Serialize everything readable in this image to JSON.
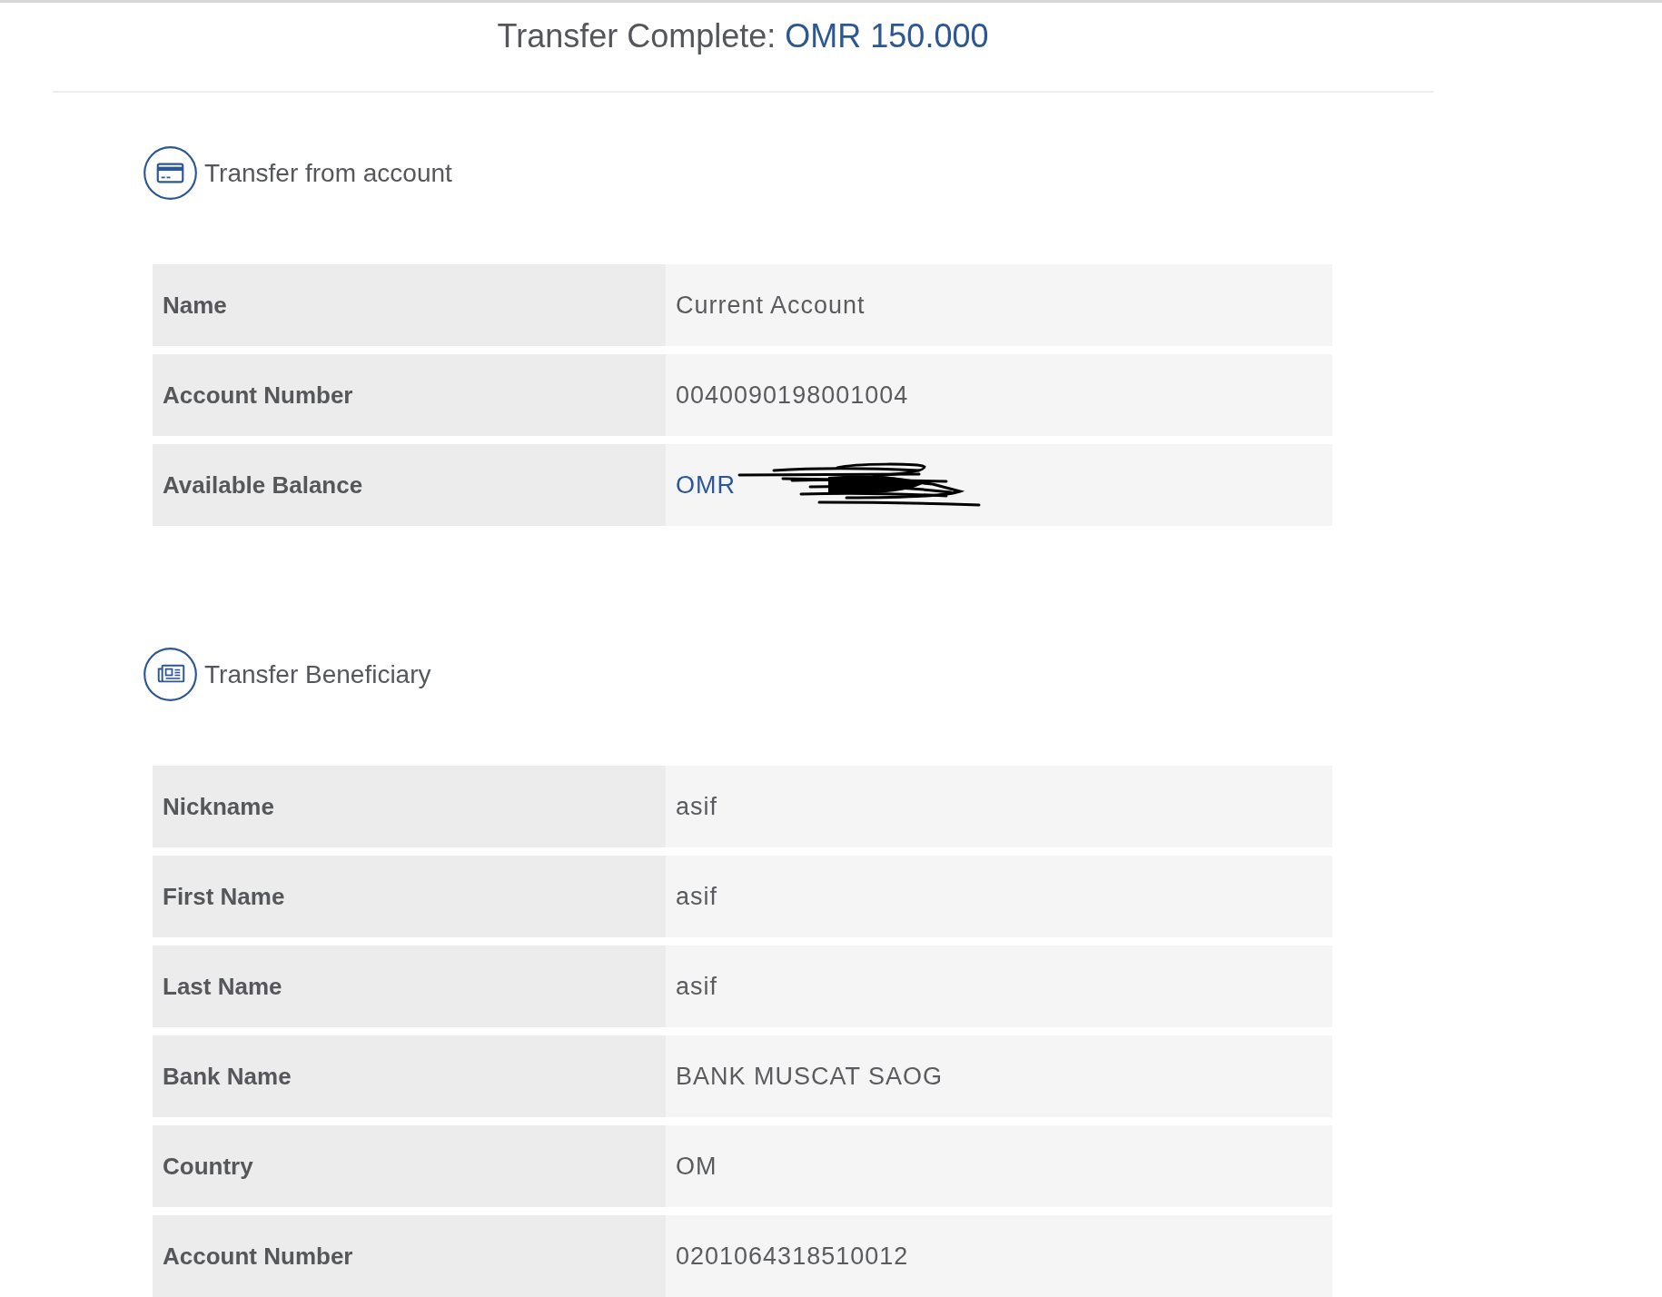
{
  "header": {
    "title": "Transfer Complete:",
    "amount": "OMR 150.000"
  },
  "sections": [
    {
      "kind": "account",
      "title": "Transfer from account",
      "rows": [
        {
          "label": "Name",
          "value": "Current Account",
          "kind": "text",
          "redacted": false
        },
        {
          "label": "Account Number",
          "value": "0040090198001004",
          "kind": "text",
          "redacted": false
        },
        {
          "label": "Available Balance",
          "value": "OMR",
          "kind": "amount",
          "redacted": true
        }
      ]
    },
    {
      "kind": "beneficiary",
      "title": "Transfer Beneficiary",
      "rows": [
        {
          "label": "Nickname",
          "value": "asif",
          "kind": "text"
        },
        {
          "label": "First Name",
          "value": "asif",
          "kind": "text"
        },
        {
          "label": "Last Name",
          "value": "asif",
          "kind": "text"
        },
        {
          "label": "Bank Name",
          "value": "BANK MUSCAT SAOG",
          "kind": "text"
        },
        {
          "label": "Country",
          "value": "OM",
          "kind": "text"
        },
        {
          "label": "Account Number",
          "value": "0201064318510012",
          "kind": "text"
        }
      ]
    }
  ]
}
